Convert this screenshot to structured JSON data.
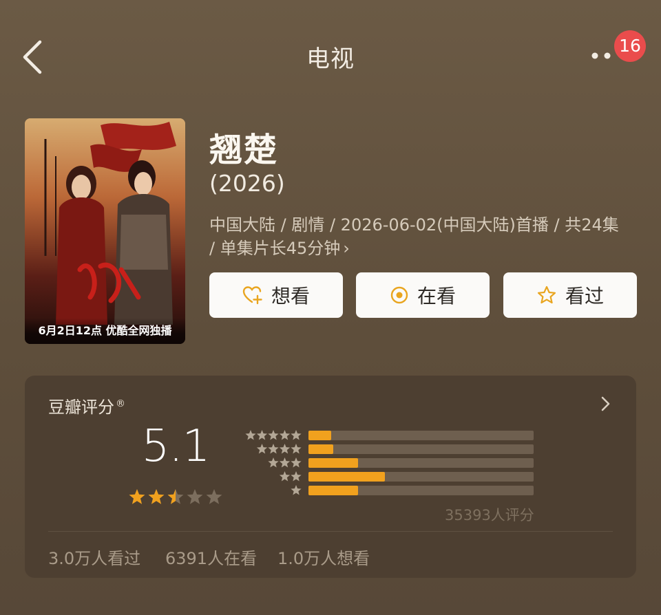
{
  "header": {
    "back_icon": "chevron-left-icon",
    "title": "电视",
    "more_icon": "more-dots-icon",
    "badge_count": "16",
    "badge_color": "#ea4c4c"
  },
  "poster": {
    "caption": "6月2日12点 优酷全网独播"
  },
  "show": {
    "title": "翘楚",
    "year": "(2026)",
    "meta": "中国大陆 / 剧情 / 2026-06-02(中国大陆)首播 / 共24集 / 单集片长45分钟",
    "meta_more": "›"
  },
  "actions": [
    {
      "label": "想看",
      "icon": "heart-plus-icon"
    },
    {
      "label": "在看",
      "icon": "target-circle-icon"
    },
    {
      "label": "看过",
      "icon": "star-outline-icon"
    }
  ],
  "accent_color": "#f1a11e",
  "rating": {
    "title": "豆瓣评分",
    "registered": "®",
    "score": "5.1",
    "stars_out_of_5": 2.5,
    "distribution": [
      {
        "stars": 5,
        "fraction": 0.1
      },
      {
        "stars": 4,
        "fraction": 0.11
      },
      {
        "stars": 3,
        "fraction": 0.22
      },
      {
        "stars": 2,
        "fraction": 0.34
      },
      {
        "stars": 1,
        "fraction": 0.22
      }
    ],
    "votes": "35393人评分",
    "stats": [
      "3.0万人看过",
      "6391人在看",
      "1.0万人想看"
    ]
  }
}
